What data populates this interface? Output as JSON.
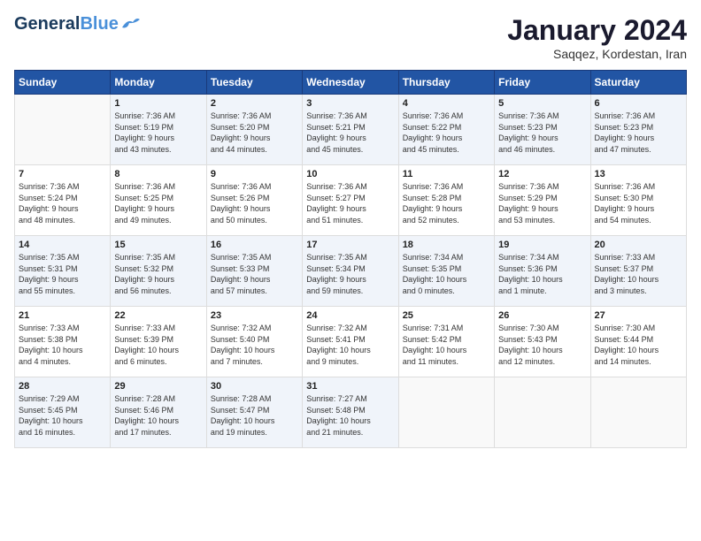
{
  "header": {
    "logo_line1": "General",
    "logo_line2": "Blue",
    "month": "January 2024",
    "location": "Saqqez, Kordestan, Iran"
  },
  "weekdays": [
    "Sunday",
    "Monday",
    "Tuesday",
    "Wednesday",
    "Thursday",
    "Friday",
    "Saturday"
  ],
  "weeks": [
    [
      {
        "day": "",
        "info": ""
      },
      {
        "day": "1",
        "info": "Sunrise: 7:36 AM\nSunset: 5:19 PM\nDaylight: 9 hours\nand 43 minutes."
      },
      {
        "day": "2",
        "info": "Sunrise: 7:36 AM\nSunset: 5:20 PM\nDaylight: 9 hours\nand 44 minutes."
      },
      {
        "day": "3",
        "info": "Sunrise: 7:36 AM\nSunset: 5:21 PM\nDaylight: 9 hours\nand 45 minutes."
      },
      {
        "day": "4",
        "info": "Sunrise: 7:36 AM\nSunset: 5:22 PM\nDaylight: 9 hours\nand 45 minutes."
      },
      {
        "day": "5",
        "info": "Sunrise: 7:36 AM\nSunset: 5:23 PM\nDaylight: 9 hours\nand 46 minutes."
      },
      {
        "day": "6",
        "info": "Sunrise: 7:36 AM\nSunset: 5:23 PM\nDaylight: 9 hours\nand 47 minutes."
      }
    ],
    [
      {
        "day": "7",
        "info": "Sunrise: 7:36 AM\nSunset: 5:24 PM\nDaylight: 9 hours\nand 48 minutes."
      },
      {
        "day": "8",
        "info": "Sunrise: 7:36 AM\nSunset: 5:25 PM\nDaylight: 9 hours\nand 49 minutes."
      },
      {
        "day": "9",
        "info": "Sunrise: 7:36 AM\nSunset: 5:26 PM\nDaylight: 9 hours\nand 50 minutes."
      },
      {
        "day": "10",
        "info": "Sunrise: 7:36 AM\nSunset: 5:27 PM\nDaylight: 9 hours\nand 51 minutes."
      },
      {
        "day": "11",
        "info": "Sunrise: 7:36 AM\nSunset: 5:28 PM\nDaylight: 9 hours\nand 52 minutes."
      },
      {
        "day": "12",
        "info": "Sunrise: 7:36 AM\nSunset: 5:29 PM\nDaylight: 9 hours\nand 53 minutes."
      },
      {
        "day": "13",
        "info": "Sunrise: 7:36 AM\nSunset: 5:30 PM\nDaylight: 9 hours\nand 54 minutes."
      }
    ],
    [
      {
        "day": "14",
        "info": "Sunrise: 7:35 AM\nSunset: 5:31 PM\nDaylight: 9 hours\nand 55 minutes."
      },
      {
        "day": "15",
        "info": "Sunrise: 7:35 AM\nSunset: 5:32 PM\nDaylight: 9 hours\nand 56 minutes."
      },
      {
        "day": "16",
        "info": "Sunrise: 7:35 AM\nSunset: 5:33 PM\nDaylight: 9 hours\nand 57 minutes."
      },
      {
        "day": "17",
        "info": "Sunrise: 7:35 AM\nSunset: 5:34 PM\nDaylight: 9 hours\nand 59 minutes."
      },
      {
        "day": "18",
        "info": "Sunrise: 7:34 AM\nSunset: 5:35 PM\nDaylight: 10 hours\nand 0 minutes."
      },
      {
        "day": "19",
        "info": "Sunrise: 7:34 AM\nSunset: 5:36 PM\nDaylight: 10 hours\nand 1 minute."
      },
      {
        "day": "20",
        "info": "Sunrise: 7:33 AM\nSunset: 5:37 PM\nDaylight: 10 hours\nand 3 minutes."
      }
    ],
    [
      {
        "day": "21",
        "info": "Sunrise: 7:33 AM\nSunset: 5:38 PM\nDaylight: 10 hours\nand 4 minutes."
      },
      {
        "day": "22",
        "info": "Sunrise: 7:33 AM\nSunset: 5:39 PM\nDaylight: 10 hours\nand 6 minutes."
      },
      {
        "day": "23",
        "info": "Sunrise: 7:32 AM\nSunset: 5:40 PM\nDaylight: 10 hours\nand 7 minutes."
      },
      {
        "day": "24",
        "info": "Sunrise: 7:32 AM\nSunset: 5:41 PM\nDaylight: 10 hours\nand 9 minutes."
      },
      {
        "day": "25",
        "info": "Sunrise: 7:31 AM\nSunset: 5:42 PM\nDaylight: 10 hours\nand 11 minutes."
      },
      {
        "day": "26",
        "info": "Sunrise: 7:30 AM\nSunset: 5:43 PM\nDaylight: 10 hours\nand 12 minutes."
      },
      {
        "day": "27",
        "info": "Sunrise: 7:30 AM\nSunset: 5:44 PM\nDaylight: 10 hours\nand 14 minutes."
      }
    ],
    [
      {
        "day": "28",
        "info": "Sunrise: 7:29 AM\nSunset: 5:45 PM\nDaylight: 10 hours\nand 16 minutes."
      },
      {
        "day": "29",
        "info": "Sunrise: 7:28 AM\nSunset: 5:46 PM\nDaylight: 10 hours\nand 17 minutes."
      },
      {
        "day": "30",
        "info": "Sunrise: 7:28 AM\nSunset: 5:47 PM\nDaylight: 10 hours\nand 19 minutes."
      },
      {
        "day": "31",
        "info": "Sunrise: 7:27 AM\nSunset: 5:48 PM\nDaylight: 10 hours\nand 21 minutes."
      },
      {
        "day": "",
        "info": ""
      },
      {
        "day": "",
        "info": ""
      },
      {
        "day": "",
        "info": ""
      }
    ]
  ]
}
